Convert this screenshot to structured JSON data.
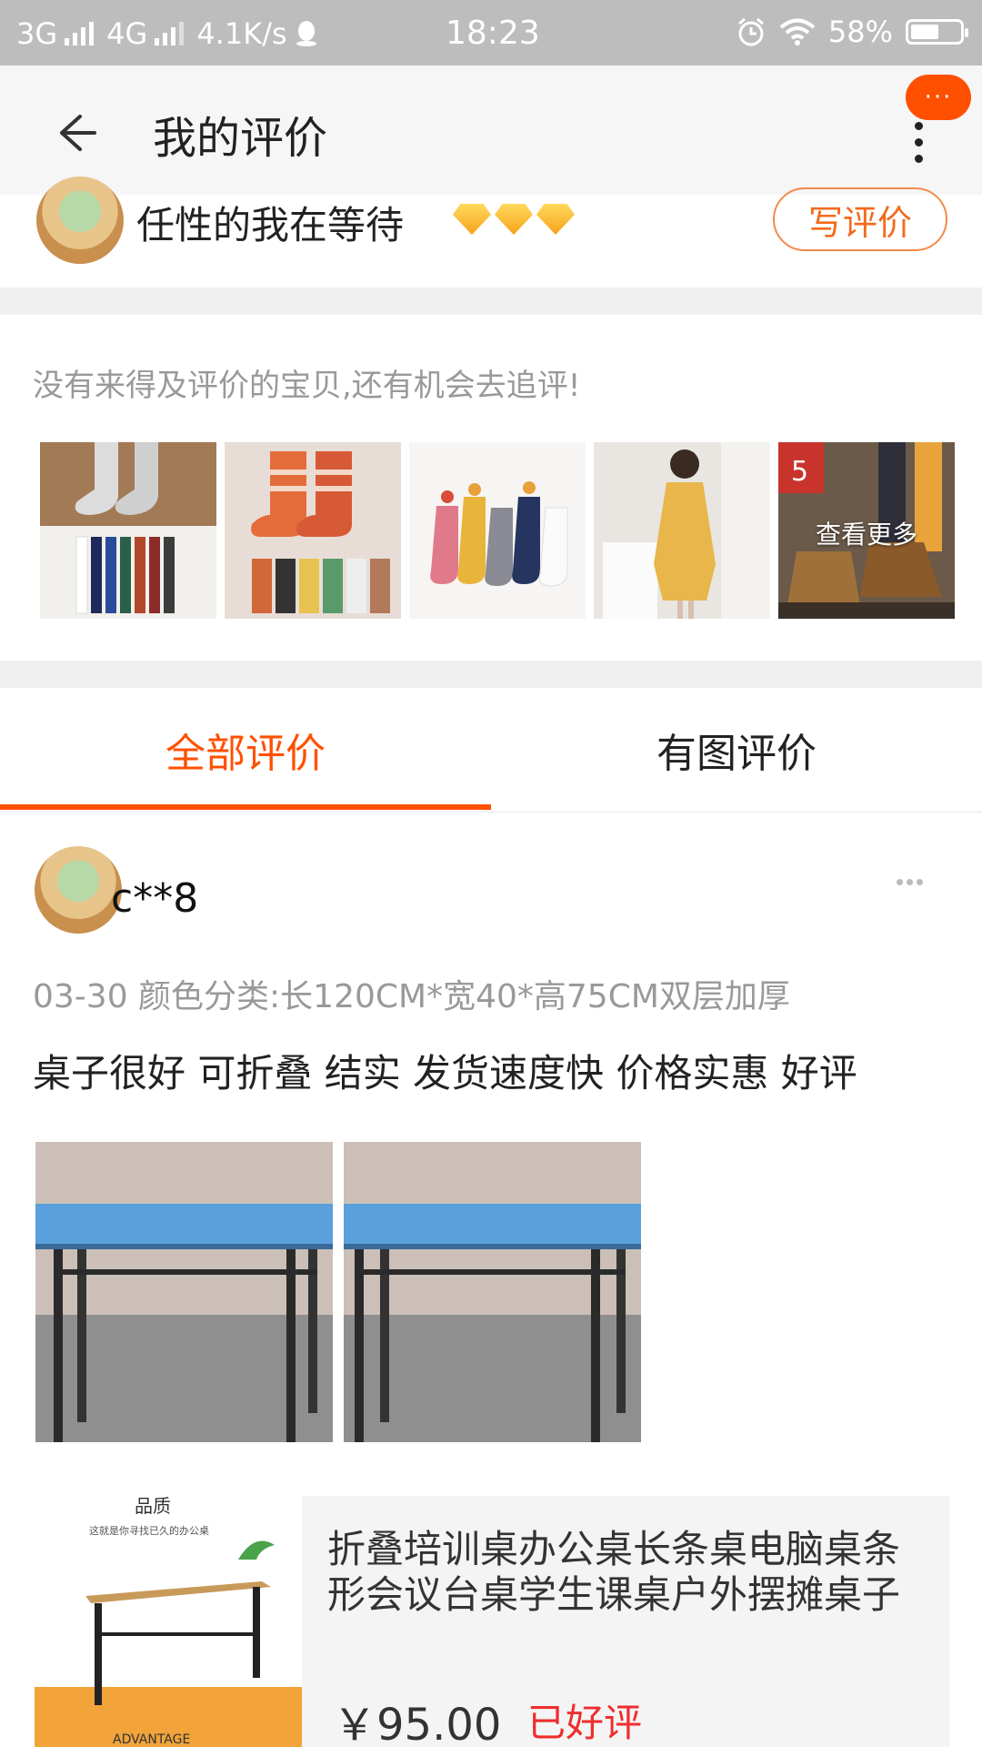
{
  "status_bar": {
    "network1": "3G",
    "network2": "4G",
    "speed": "4.1K/s",
    "time": "18:23",
    "battery": "58%",
    "battery_level": 0.58
  },
  "header": {
    "title": "我的评价",
    "badge": "···"
  },
  "user": {
    "name": "任性的我在等待",
    "gem_count": 3,
    "write_review_label": "写评价"
  },
  "pending": {
    "hint": "没有来得及评价的宝贝,还有机会去追评!",
    "more_label": "查看更多"
  },
  "tabs": [
    {
      "label": "全部评价",
      "active": true
    },
    {
      "label": "有图评价",
      "active": false
    }
  ],
  "review": {
    "user": "c**8",
    "meta": "03-30  颜色分类:长120CM*宽40*高75CM双层加厚",
    "text": "桌子很好 可折叠 结实  发货速度快  价格实惠  好评"
  },
  "product": {
    "title": "折叠培训桌办公桌长条桌电脑桌条形会议台桌学生课桌户外摆摊桌子",
    "price": "￥95.00",
    "status": "已好评",
    "image_text_1": "品质",
    "image_text_2": "这就是你寻找已久的办公桌",
    "image_text_3": "ADVANTAGE"
  },
  "colors": {
    "accent": "#ff5000",
    "status_red": "#f02d2d",
    "write_border": "#f28a4a"
  }
}
